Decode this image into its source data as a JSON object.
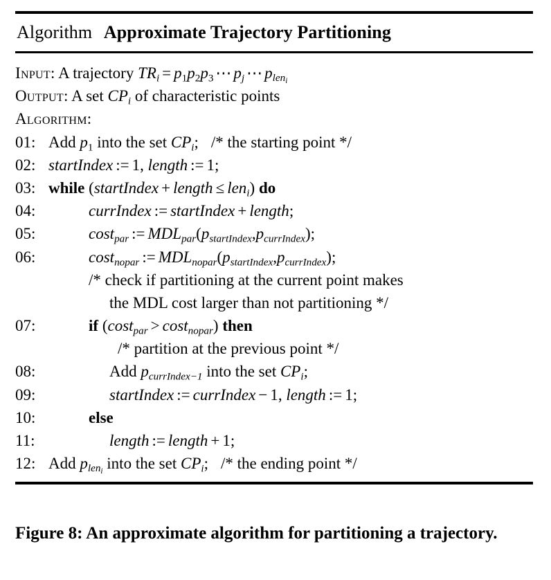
{
  "figure": {
    "algorithm_label": "Algorithm",
    "algorithm_name": "Approximate Trajectory Partitioning",
    "caption": "Figure 8:  An approximate algorithm for partitioning a trajectory."
  },
  "header": {
    "input_label": "Input:",
    "input_text_a": "A trajectory",
    "input_tr": "TR",
    "input_tr_sub": "i",
    "input_eq": "=",
    "input_seq_p": "p",
    "input_seq_1": "1",
    "input_seq_2": "2",
    "input_seq_3": "3",
    "input_dots": "⋯",
    "input_pj_sub": "j",
    "input_plen_sub": "len",
    "input_plen_subsub": "i",
    "output_label": "Output:",
    "output_text_a": "A set",
    "output_cp": "CP",
    "output_cp_sub": "i",
    "output_text_b": "of characteristic points",
    "algorithm_label": "Algorithm:"
  },
  "lines": {
    "l01": {
      "num": "01:",
      "add": "Add",
      "p": "p",
      "p_sub": "1",
      "into_the_set": "into the set",
      "cp": "CP",
      "cp_sub": "i",
      "semi": ";",
      "comment": "/* the starting point */"
    },
    "l02": {
      "num": "02:",
      "startIndex": "startIndex",
      "assign": ":=",
      "one": "1",
      "comma": ",",
      "length": "length",
      "assign2": ":=",
      "one2": "1",
      "semi": ";"
    },
    "l03": {
      "num": "03:",
      "while": "while",
      "lparen": "(",
      "startIndex": "startIndex",
      "plus": "+",
      "length": "length",
      "leq": "≤",
      "len": "len",
      "len_sub": "i",
      "rparen": ")",
      "do": "do"
    },
    "l04": {
      "num": "04:",
      "currIndex": "currIndex",
      "assign": ":=",
      "startIndex": "startIndex",
      "plus": "+",
      "length": "length",
      "semi": ";"
    },
    "l05": {
      "num": "05:",
      "cost": "cost",
      "cost_sub": "par",
      "assign": ":=",
      "mdl": "MDL",
      "mdl_sub": "par",
      "lparen": "(",
      "p1": "p",
      "p1_sub": "startIndex",
      "comma": ",",
      "p2": "p",
      "p2_sub": "currIndex",
      "rparen": ")",
      "semi": ";"
    },
    "l06": {
      "num": "06:",
      "cost": "cost",
      "cost_sub": "nopar",
      "assign": ":=",
      "mdl": "MDL",
      "mdl_sub": "nopar",
      "lparen": "(",
      "p1": "p",
      "p1_sub": "startIndex",
      "comma": ",",
      "p2": "p",
      "p2_sub": "currIndex",
      "rparen": ")",
      "semi": ";"
    },
    "c06a": "/* check if partitioning at the current point makes",
    "c06b": "the MDL cost larger than not partitioning */",
    "l07": {
      "num": "07:",
      "if": "if",
      "lparen": "(",
      "cost1": "cost",
      "cost1_sub": "par",
      "gt": ">",
      "cost2": "cost",
      "cost2_sub": "nopar",
      "rparen": ")",
      "then": "then"
    },
    "c07": "/* partition at the previous point */",
    "l08": {
      "num": "08:",
      "add": "Add",
      "p": "p",
      "p_sub": "currIndex−1",
      "into_the_set": "into the set",
      "cp": "CP",
      "cp_sub": "i",
      "semi": ";"
    },
    "l09": {
      "num": "09:",
      "startIndex": "startIndex",
      "assign": ":=",
      "currIndex": "currIndex",
      "minus": "−",
      "one": "1",
      "comma": ",",
      "length": "length",
      "assign2": ":=",
      "one2": "1",
      "semi": ";"
    },
    "l10": {
      "num": "10:",
      "else": "else"
    },
    "l11": {
      "num": "11:",
      "length": "length",
      "assign": ":=",
      "length2": "length",
      "plus": "+",
      "one": "1",
      "semi": ";"
    },
    "l12": {
      "num": "12:",
      "add": "Add",
      "p": "p",
      "p_sub": "len",
      "p_subsub": "i",
      "into_the_set": "into the set",
      "cp": "CP",
      "cp_sub": "i",
      "semi": ";",
      "comment": "/* the ending point */"
    }
  }
}
